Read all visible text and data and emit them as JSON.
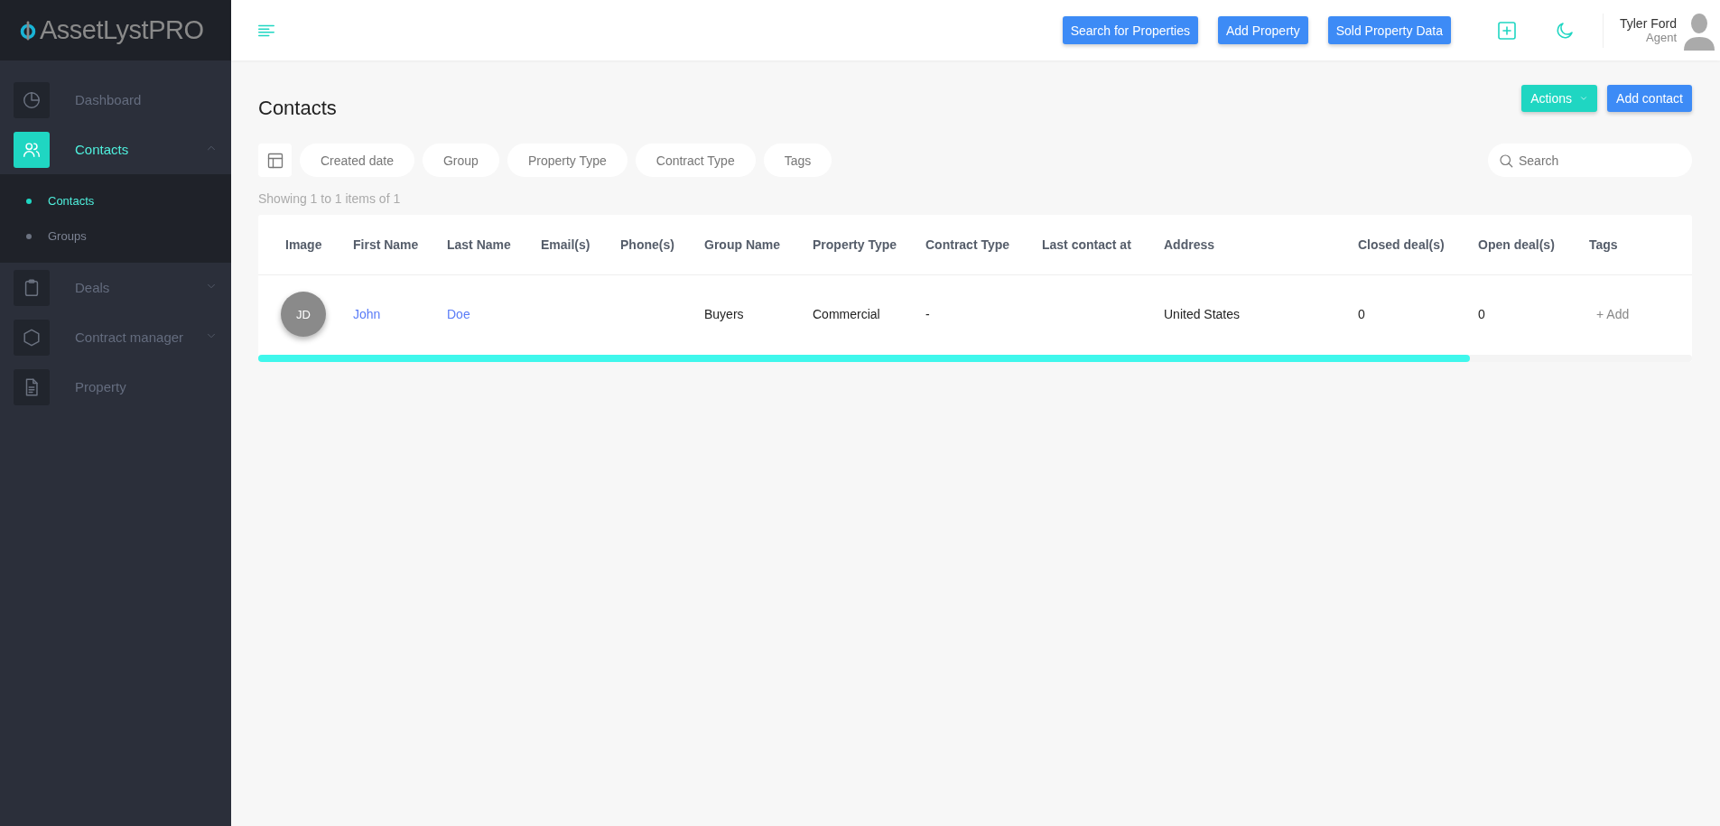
{
  "brand": {
    "name": "AssetLystPRO"
  },
  "sidebar": {
    "items": [
      {
        "label": "Dashboard",
        "kind": "link",
        "selected": false
      },
      {
        "label": "Contacts",
        "kind": "menu",
        "selected": true,
        "expanded": true,
        "children": [
          {
            "label": "Contacts",
            "selected": true
          },
          {
            "label": "Groups",
            "selected": false
          }
        ]
      },
      {
        "label": "Deals",
        "kind": "menu",
        "selected": false,
        "expanded": false
      },
      {
        "label": "Contract manager",
        "kind": "menu",
        "selected": false,
        "expanded": false
      },
      {
        "label": "Property",
        "kind": "link",
        "selected": false
      }
    ]
  },
  "topbar": {
    "buttons": [
      "Search for Properties",
      "Add Property",
      "Sold Property Data"
    ],
    "user": {
      "name": "Tyler Ford",
      "role": "Agent"
    }
  },
  "page": {
    "title": "Contacts",
    "actions": [
      {
        "label": "Actions",
        "kind": "dropdown"
      },
      {
        "label": "Add contact",
        "kind": "primary"
      }
    ],
    "filters": [
      "Created date",
      "Group",
      "Property Type",
      "Contract Type",
      "Tags"
    ],
    "search": {
      "placeholder": "Search"
    },
    "summary": "Showing 1 to 1 items of 1"
  },
  "table": {
    "columns": [
      "Image",
      "First Name",
      "Last Name",
      "Email(s)",
      "Phone(s)",
      "Group Name",
      "Property Type",
      "Contract Type",
      "Last contact at",
      "Address",
      "Closed deal(s)",
      "Open deal(s)",
      "Tags"
    ],
    "rows": [
      {
        "cells": [
          {
            "kind": "avatar",
            "text": "JD"
          },
          {
            "kind": "link",
            "text": "John"
          },
          {
            "kind": "link",
            "text": "Doe"
          },
          null,
          null,
          {
            "kind": "text",
            "text": "Buyers"
          },
          {
            "kind": "text",
            "text": "Commercial"
          },
          {
            "kind": "text",
            "text": "-"
          },
          null,
          {
            "kind": "text",
            "text": "United States"
          },
          {
            "kind": "text",
            "text": "0"
          },
          {
            "kind": "text",
            "text": "0"
          },
          {
            "kind": "action",
            "text": "+ Add"
          }
        ]
      }
    ]
  }
}
